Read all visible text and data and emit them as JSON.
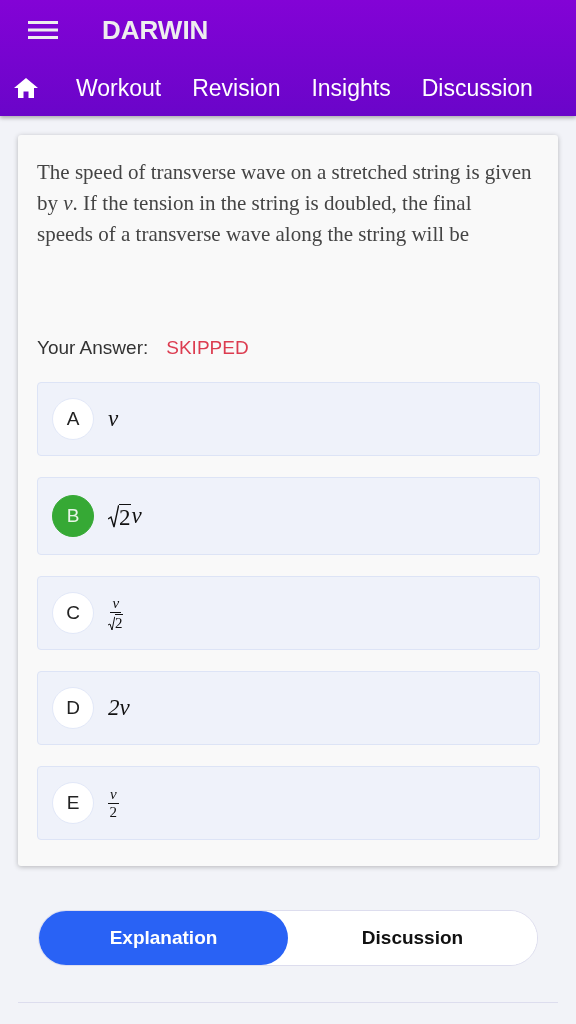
{
  "app_bar": {
    "title": "DARWIN"
  },
  "nav_tabs": [
    {
      "label": "Workout"
    },
    {
      "label": "Revision"
    },
    {
      "label": "Insights"
    },
    {
      "label": "Discussion"
    }
  ],
  "question": {
    "text": "The speed of transverse wave on a stretched string is given by *v*. If the tension in the string is doubled, the final speeds of a transverse wave along the string will be"
  },
  "answer": {
    "label": "Your Answer:",
    "value": "SKIPPED"
  },
  "options": [
    {
      "letter": "A",
      "correct": false,
      "kind": "text",
      "text": "v"
    },
    {
      "letter": "B",
      "correct": true,
      "kind": "root_times",
      "radicand": "2",
      "factor": "v"
    },
    {
      "letter": "C",
      "correct": false,
      "kind": "frac_root",
      "numerator": "v",
      "radicand": "2"
    },
    {
      "letter": "D",
      "correct": false,
      "kind": "text",
      "text": "2v"
    },
    {
      "letter": "E",
      "correct": false,
      "kind": "frac",
      "numerator": "v",
      "denominator": "2"
    }
  ],
  "toggle": [
    {
      "label": "Explanation",
      "selected": true
    },
    {
      "label": "Discussion",
      "selected": false
    }
  ]
}
